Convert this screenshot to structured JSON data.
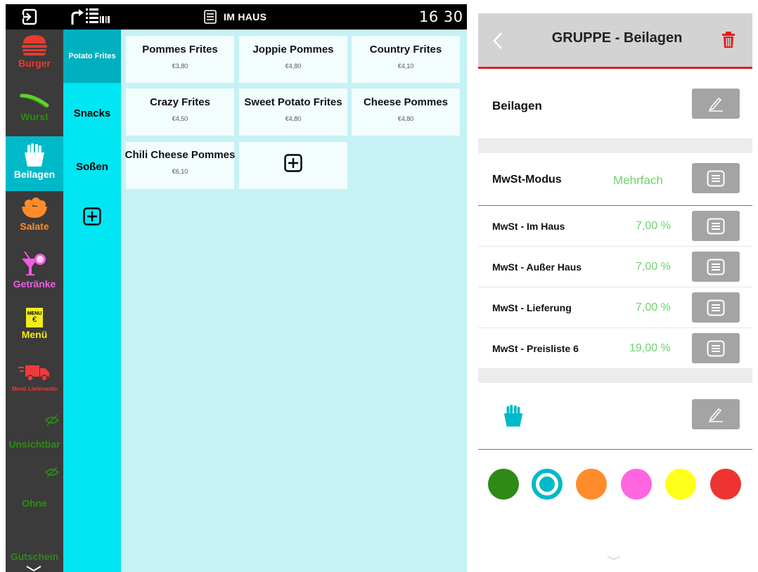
{
  "topbar": {
    "mode_label": "IM HAUS",
    "clock": "16 30"
  },
  "categories": [
    {
      "label": "Burger",
      "color": "#e63b2e",
      "icon": "burger-icon"
    },
    {
      "label": "Wurst",
      "color": "#2e8a14",
      "icon": "sausage-icon"
    },
    {
      "label": "Beilagen",
      "color": "#ffffff",
      "icon": "fries-icon"
    },
    {
      "label": "Salate",
      "color": "#ff8c2a",
      "icon": "salad-icon"
    },
    {
      "label": "Getränke",
      "color": "#f05ce4",
      "icon": "drink-icon"
    },
    {
      "label": "Menü",
      "color": "#f2ee19",
      "icon": "menu-icon"
    },
    {
      "label": "Menü Lieferando",
      "color": "#ee3a3a",
      "icon": "delivery-truck-icon"
    },
    {
      "label": "Unsichtbar",
      "color": "#2e8a14",
      "icon": "eye-off-icon"
    },
    {
      "label": "Ohne",
      "color": "#2e8a14",
      "icon": ""
    },
    {
      "label": "Gutschein",
      "color": "#2e8a14",
      "icon": ""
    }
  ],
  "menu_icon_text": "MENU",
  "menu_icon_euro": "€",
  "groups": [
    {
      "label": "Potato Frites"
    },
    {
      "label": "Snacks"
    },
    {
      "label": "Soßen"
    }
  ],
  "products": [
    {
      "name": "Pommes Frites",
      "price": "€3,80"
    },
    {
      "name": "Joppie Pommes",
      "price": "€4,80"
    },
    {
      "name": "Country Frites",
      "price": "€4,10"
    },
    {
      "name": "Crazy Frites",
      "price": "€4,50"
    },
    {
      "name": "Sweet Potato Frites",
      "price": "€4,80"
    },
    {
      "name": "Cheese Pommes",
      "price": "€4,80"
    },
    {
      "name": "Chili Cheese Pommes",
      "price": "€6,10"
    }
  ],
  "panel": {
    "title": "GRUPPE - Beilagen",
    "name_value": "Beilagen",
    "vat_mode_label": "MwSt-Modus",
    "vat_mode_value": "Mehrfach",
    "vat_rows": [
      {
        "label": "MwSt - Im Haus",
        "value": "7,00 %"
      },
      {
        "label": "MwSt - Außer Haus",
        "value": "7,00 %"
      },
      {
        "label": "MwSt - Lieferung",
        "value": "7,00 %"
      },
      {
        "label": "MwSt - Preisliste 6",
        "value": "19,00 %"
      }
    ],
    "icon": "fries-icon",
    "accent_color": "#e0201e",
    "value_color": "#6fd36a",
    "colors": [
      "#2e8a14",
      "#00b9c8",
      "#ff8c2a",
      "#ff66e0",
      "#ffff1a",
      "#ee3333"
    ],
    "selected_color_index": 1
  }
}
